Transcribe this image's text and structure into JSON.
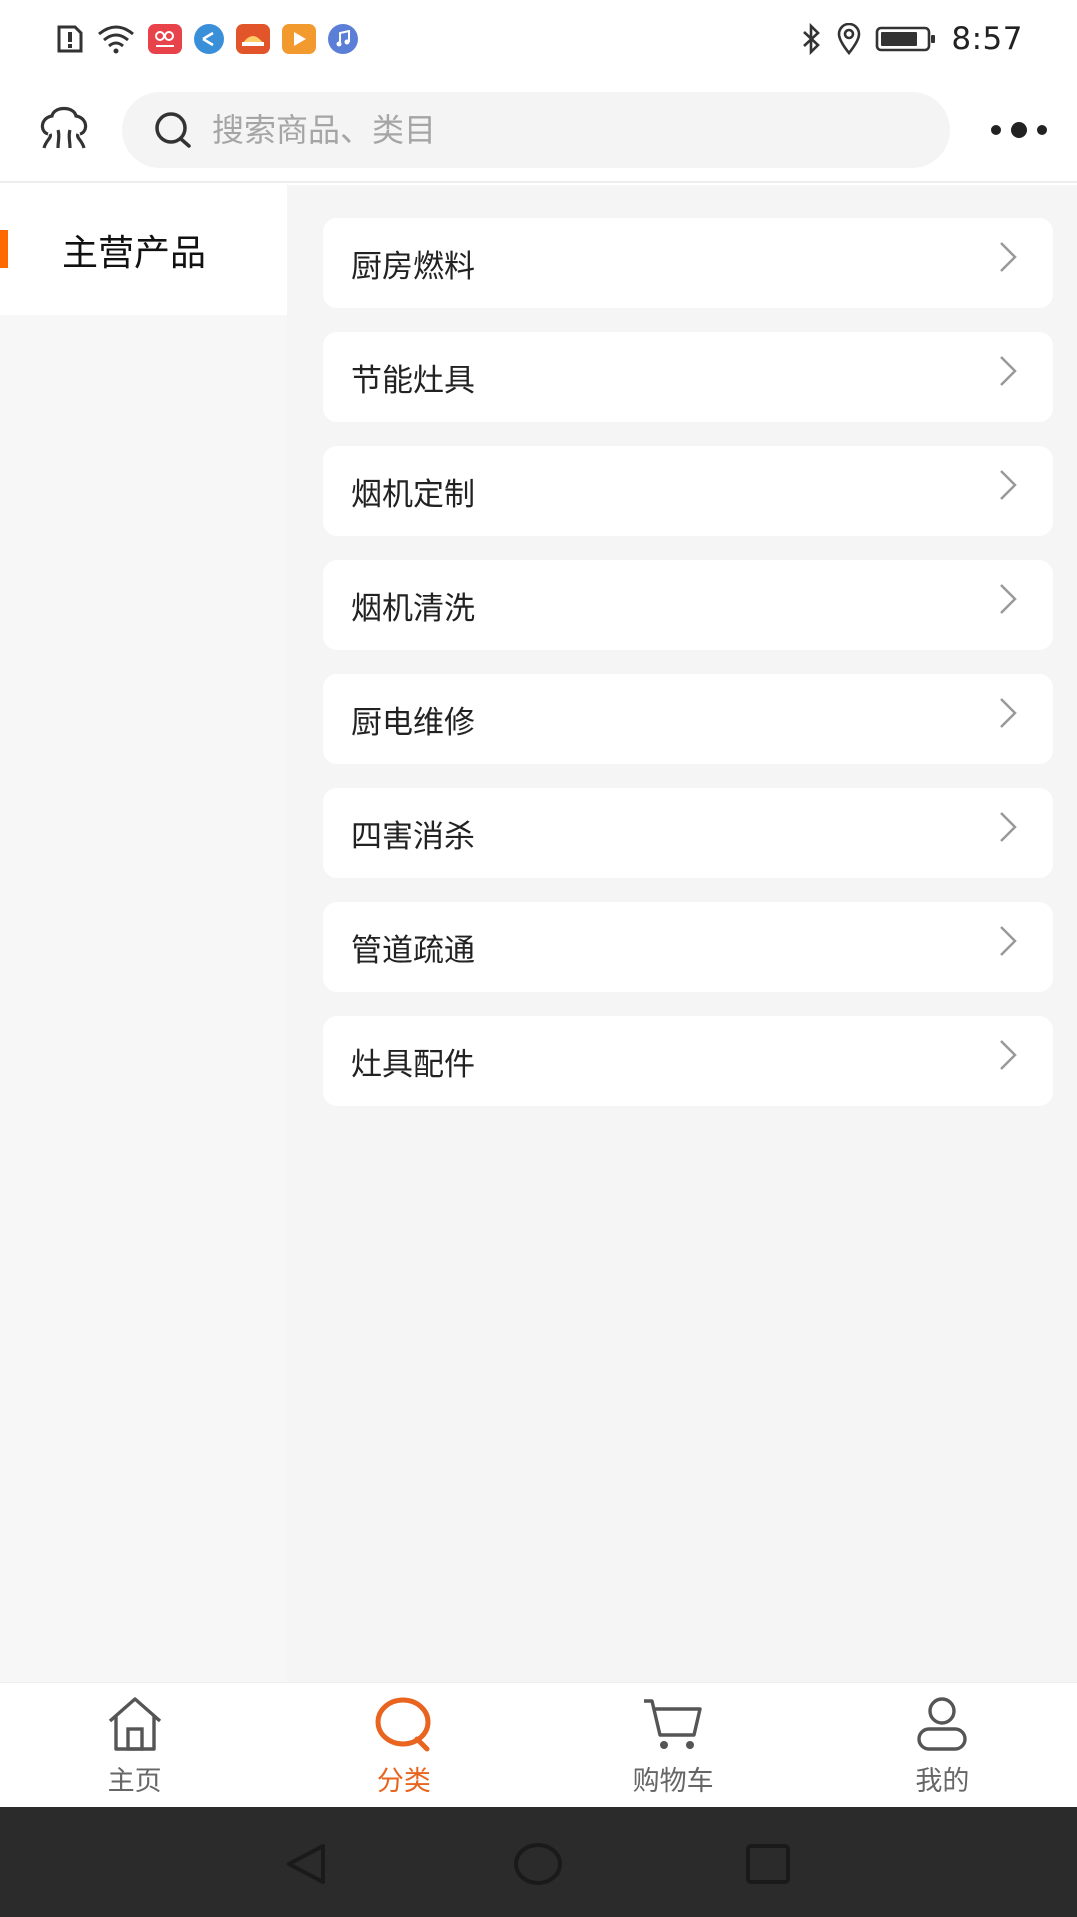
{
  "status_bar": {
    "time": "8:57",
    "left_icons": [
      "alert-icon",
      "wifi-icon",
      "app-icon-red",
      "app-icon-blue-globe",
      "app-icon-red-car",
      "app-icon-orange-play",
      "app-icon-music"
    ],
    "right_icons": [
      "bluetooth-icon",
      "location-icon",
      "battery-icon"
    ]
  },
  "header": {
    "search_placeholder": "搜索商品、类目"
  },
  "sidebar": {
    "items": [
      {
        "label": "主营产品",
        "active": true
      }
    ]
  },
  "categories": [
    {
      "label": "厨房燃料"
    },
    {
      "label": "节能灶具"
    },
    {
      "label": "烟机定制"
    },
    {
      "label": "烟机清洗"
    },
    {
      "label": "厨电维修"
    },
    {
      "label": "四害消杀"
    },
    {
      "label": "管道疏通"
    },
    {
      "label": "灶具配件"
    }
  ],
  "tabbar": {
    "tabs": [
      {
        "label": "主页",
        "icon": "home-icon",
        "active": false
      },
      {
        "label": "分类",
        "icon": "category-search-icon",
        "active": true
      },
      {
        "label": "购物车",
        "icon": "cart-icon",
        "active": false
      },
      {
        "label": "我的",
        "icon": "profile-icon",
        "active": false
      }
    ]
  },
  "colors": {
    "accent": "#ff6a00",
    "active_tab": "#e8641f",
    "sidebar_bg": "#f7f7f7",
    "content_bg": "#f5f5f5",
    "navbar_bg": "#2b2b2b"
  }
}
